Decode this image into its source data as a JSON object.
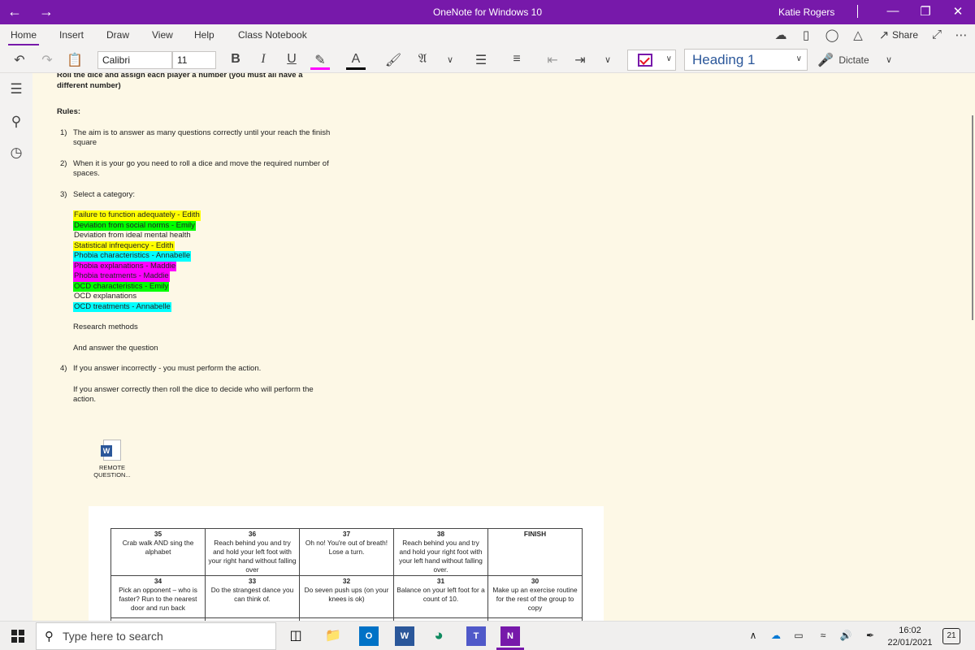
{
  "window": {
    "title": "OneNote for Windows 10",
    "user": "Katie Rogers"
  },
  "menu": {
    "tabs": [
      "Home",
      "Insert",
      "Draw",
      "View",
      "Help",
      "Class Notebook"
    ],
    "share_label": "Share"
  },
  "toolbar": {
    "font_name": "Calibri",
    "font_size": "11",
    "style": "Heading 1",
    "dictate_label": "Dictate",
    "bold": "B",
    "italic": "I",
    "underline": "U",
    "font_color_glyph": "A"
  },
  "page": {
    "intro": "Roll the dice and assign each player a number (you must all have a different number)",
    "rules_heading": "Rules:",
    "rule1_num": "1)",
    "rule1": "The aim is to answer as many questions correctly until your reach the finish square",
    "rule2_num": "2)",
    "rule2": "When it is your go you need to roll a dice and move the required number of spaces.",
    "rule3_num": "3)",
    "rule3": "Select a category:",
    "categories": [
      {
        "text": "Failure to function adequately - Edith",
        "highlight": "#ffff00"
      },
      {
        "text": "Deviation from social norms - Emily",
        "highlight": "#00ff00"
      },
      {
        "text": "Deviation from ideal mental health",
        "highlight": ""
      },
      {
        "text": "Statistical infrequency - Edith",
        "highlight": "#ffff00"
      },
      {
        "text": "Phobia characteristics - Annabelle",
        "highlight": "#00ffff"
      },
      {
        "text": "Phobia explanations - Maddie",
        "highlight": "#ff00ff"
      },
      {
        "text": "Phobia treatments - Maddie",
        "highlight": "#ff00ff"
      },
      {
        "text": "OCD characteristics - Emily",
        "highlight": "#00ff00"
      },
      {
        "text": "OCD explanations",
        "highlight": ""
      },
      {
        "text": "OCD treatments - Annabelle",
        "highlight": "#00ffff"
      }
    ],
    "research": "Research methods",
    "answer": "And answer the question",
    "rule4_num": "4)",
    "rule4": "If you answer incorrectly - you must perform the action.",
    "rule4b": "If you answer correctly then roll the dice to decide who will perform the action.",
    "attachment_name": "REMOTE QUESTION..."
  },
  "board": {
    "row1": [
      {
        "n": "35",
        "t": "Crab walk AND sing the alphabet"
      },
      {
        "n": "36",
        "t": "Reach behind you and try and hold your left foot with your right hand without falling over"
      },
      {
        "n": "37",
        "t": "Oh no! You're out of breath! Lose a turn."
      },
      {
        "n": "38",
        "t": "Reach behind you and try and hold your right foot with your left hand without falling over."
      },
      {
        "n": "",
        "t": "FINISH"
      }
    ],
    "row2": [
      {
        "n": "34",
        "t": "Pick an opponent – who is faster? Run to the nearest door and run back"
      },
      {
        "n": "33",
        "t": "Do the strangest dance you can think of."
      },
      {
        "n": "32",
        "t": "Do seven push ups (on your knees is ok)"
      },
      {
        "n": "31",
        "t": "Balance on your left foot for a count of 10."
      },
      {
        "n": "30",
        "t": "Make up an exercise routine for the rest of the group to copy"
      }
    ]
  },
  "taskbar": {
    "search_placeholder": "Type here to search",
    "time": "16:02",
    "date": "22/01/2021",
    "notifications": "21"
  }
}
